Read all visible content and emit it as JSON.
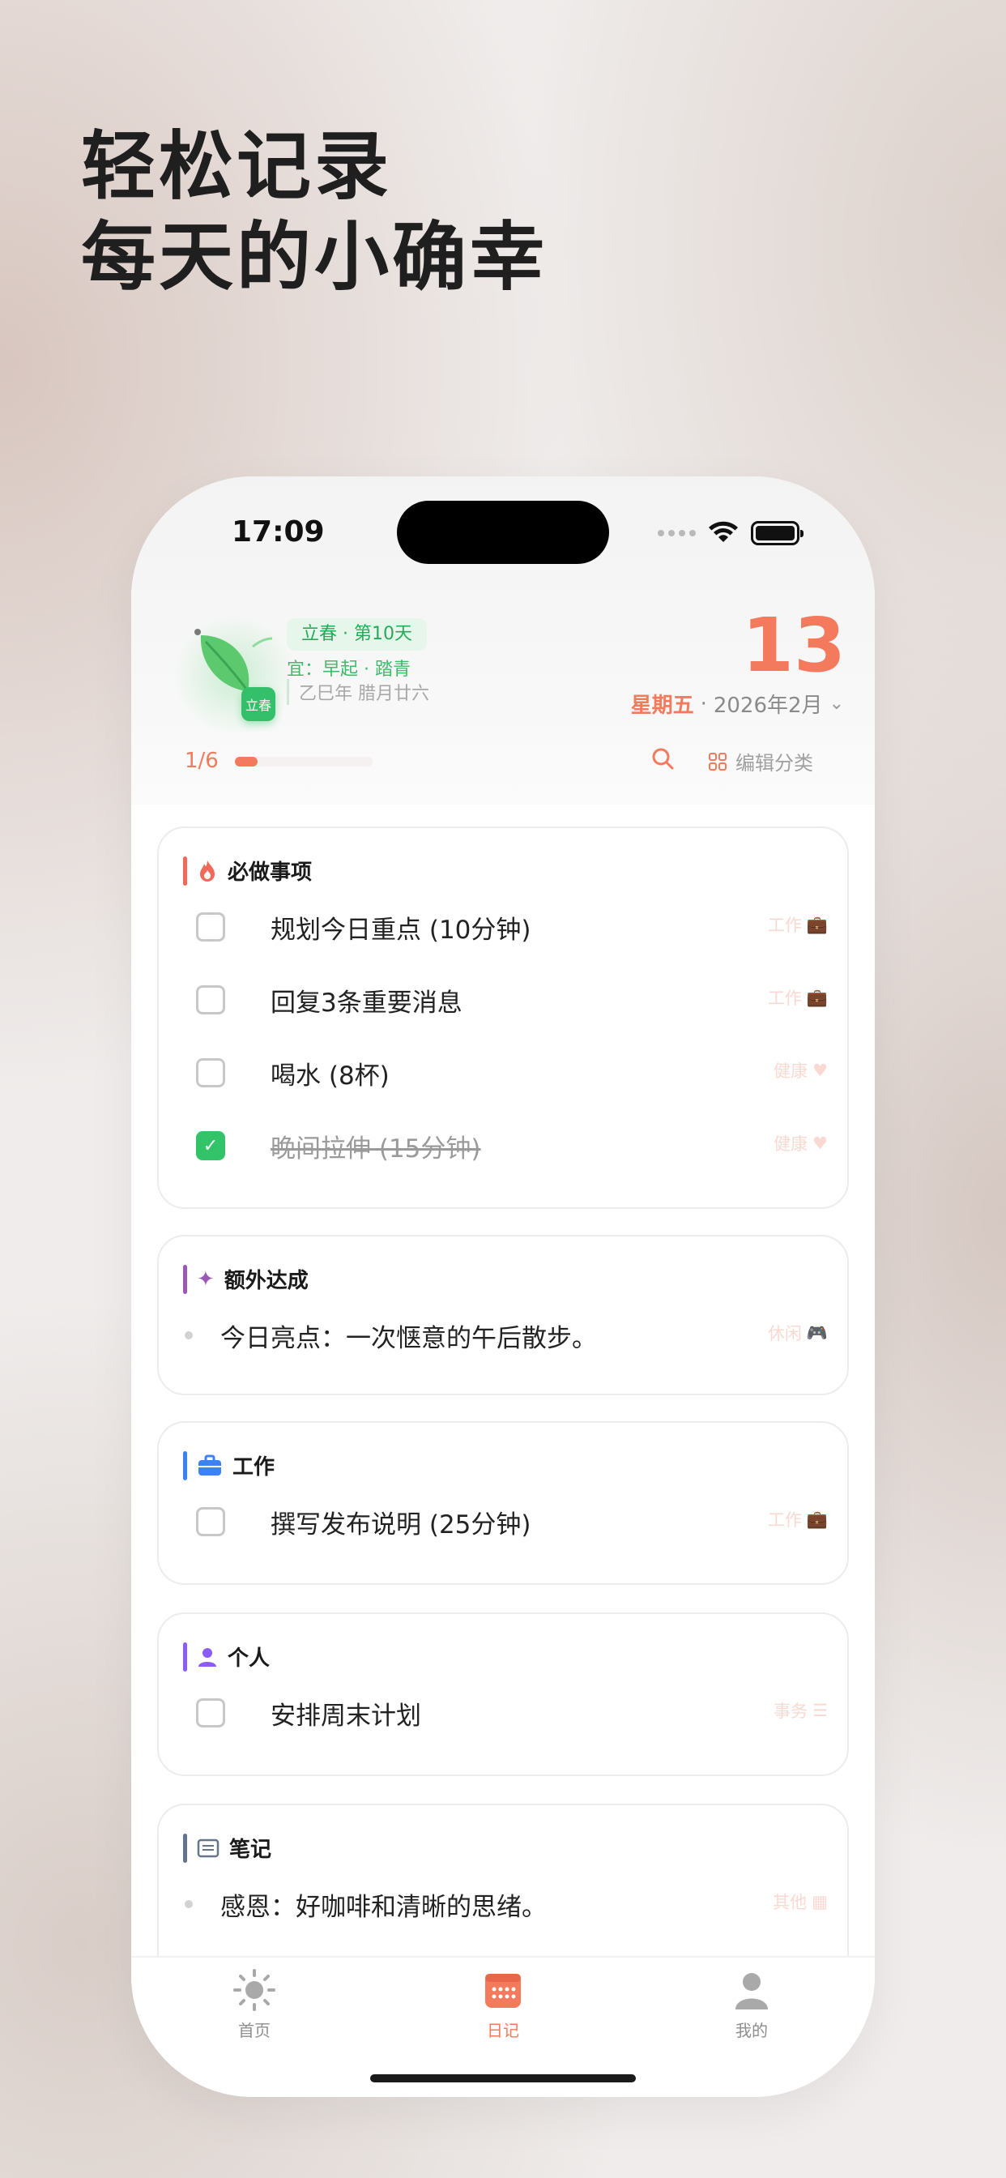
{
  "headline": {
    "line1": "轻松记录",
    "line2": "每天的小确幸"
  },
  "status_bar": {
    "time": "17:09"
  },
  "solar_term": {
    "badge": "立春",
    "pill": "立春 · 第10天",
    "yi": "宜：早起 · 踏青",
    "lunar": "乙巳年 腊月廿六"
  },
  "date": {
    "day": "13",
    "weekday": "星期五",
    "separator": "·",
    "month": "2026年2月"
  },
  "progress": {
    "label": "1/6",
    "fraction": 0.1667
  },
  "toolbar": {
    "edit_label": "编辑分类"
  },
  "sections": [
    {
      "title": "必做事项",
      "accent": "#f2695a",
      "icon": "flame-icon",
      "items": [
        {
          "text": "规划今日重点 (10分钟)",
          "done": false,
          "tag": "工作",
          "tag_icon": "briefcase-icon"
        },
        {
          "text": "回复3条重要消息",
          "done": false,
          "tag": "工作",
          "tag_icon": "briefcase-icon"
        },
        {
          "text": "喝水 (8杯)",
          "done": false,
          "tag": "健康",
          "tag_icon": "heart-icon"
        },
        {
          "text": "晚间拉伸 (15分钟)",
          "done": true,
          "tag": "健康",
          "tag_icon": "heart-icon"
        }
      ]
    },
    {
      "title": "额外达成",
      "accent": "#9b59b6",
      "icon": "sparkle-icon",
      "items": [
        {
          "text": "今日亮点：一次惬意的午后散步。",
          "bullet": true,
          "tag": "休闲",
          "tag_icon": "gamepad-icon"
        }
      ]
    },
    {
      "title": "工作",
      "accent": "#3b82f6",
      "icon": "briefcase-icon",
      "items": [
        {
          "text": "撰写发布说明 (25分钟)",
          "done": false,
          "tag": "工作",
          "tag_icon": "briefcase-icon"
        }
      ]
    },
    {
      "title": "个人",
      "accent": "#8b5cf6",
      "icon": "person-icon",
      "items": [
        {
          "text": "安排周末计划",
          "done": false,
          "tag": "事务",
          "tag_icon": "checklist-icon"
        }
      ]
    },
    {
      "title": "笔记",
      "accent": "#64748b",
      "icon": "note-icon",
      "items": [
        {
          "text": "感恩：好咖啡和清晰的思绪。",
          "bullet": true,
          "tag": "其他",
          "tag_icon": "grid-icon"
        }
      ]
    }
  ],
  "tabbar": {
    "tabs": [
      {
        "label": "首页",
        "icon": "sun-icon"
      },
      {
        "label": "日记",
        "icon": "calendar-icon",
        "active": true
      },
      {
        "label": "我的",
        "icon": "person-icon"
      }
    ]
  }
}
